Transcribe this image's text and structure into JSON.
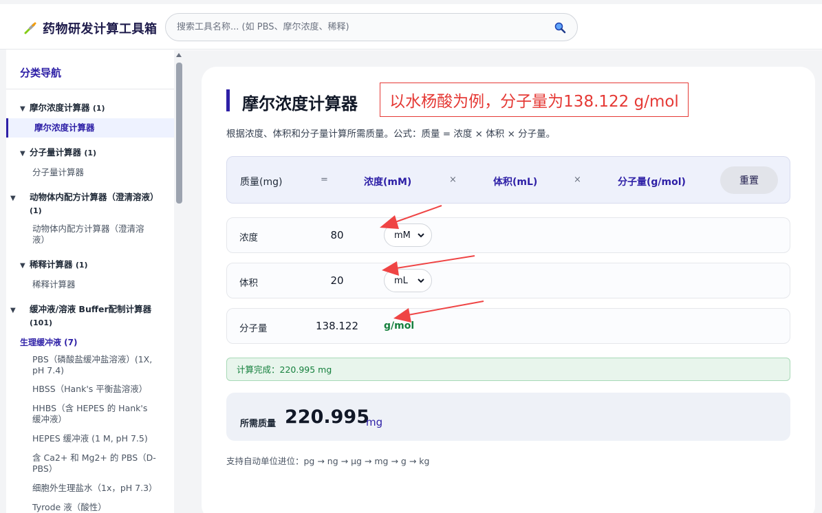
{
  "header": {
    "title": "药物研发计算工具箱",
    "search_placeholder": "搜索工具名称... (如 PBS、摩尔浓度、稀释)"
  },
  "sidebar": {
    "title": "分类导航",
    "groups": [
      {
        "label": "摩尔浓度计算器",
        "count": "(1)",
        "items": [
          "摩尔浓度计算器"
        ]
      },
      {
        "label": "分子量计算器",
        "count": "(1)",
        "items": [
          "分子量计算器"
        ]
      },
      {
        "label": "动物体内配方计算器（澄清溶液）",
        "count": "(1)",
        "items": [
          "动物体内配方计算器（澄清溶液）"
        ]
      },
      {
        "label": "稀释计算器",
        "count": "(1)",
        "items": [
          "稀释计算器"
        ]
      },
      {
        "label": "缓冲液/溶液 Buffer配制计算器",
        "count": "(101)",
        "items": []
      }
    ],
    "subgroup": {
      "label": "生理缓冲液 (7)",
      "items": [
        "PBS（磷酸盐缓冲盐溶液）(1X, pH 7.4)",
        "HBSS（Hank's 平衡盐溶液）",
        "HHBS（含 HEPES 的 Hank's 缓冲液）",
        "HEPES 缓冲液 (1 M, pH 7.5)",
        "含 Ca2+ 和 Mg2+ 的 PBS（D-PBS）",
        "细胞外生理盐水（1x，pH 7.3）",
        "Tyrode 液（酸性）"
      ]
    }
  },
  "main": {
    "title": "摩尔浓度计算器",
    "annotation": "以水杨酸为例，分子量为138.122 g/mol",
    "description": "根据浓度、体积和分子量计算所需质量。公式：质量 = 浓度 × 体积 × 分子量。",
    "formula": {
      "mass": "质量(mg)",
      "eq": "=",
      "conc": "浓度(mM)",
      "times": "×",
      "vol": "体积(mL)",
      "mw": "分子量(g/mol)",
      "reset": "重置"
    },
    "rows": {
      "conc": {
        "label": "浓度",
        "value": "80",
        "unit": "mM"
      },
      "vol": {
        "label": "体积",
        "value": "20",
        "unit": "mL"
      },
      "mw": {
        "label": "分子量",
        "value": "138.122",
        "unit": "g/mol"
      }
    },
    "status": "计算完成：220.995 mg",
    "result": {
      "label": "所需质量",
      "value": "220.995",
      "unit": "mg"
    },
    "footnote": "支持自动单位进位：pg → ng → µg → mg → g → kg"
  },
  "colors": {
    "accent": "#2d1fa6",
    "annotation": "#e53935",
    "success": "#15803d"
  }
}
